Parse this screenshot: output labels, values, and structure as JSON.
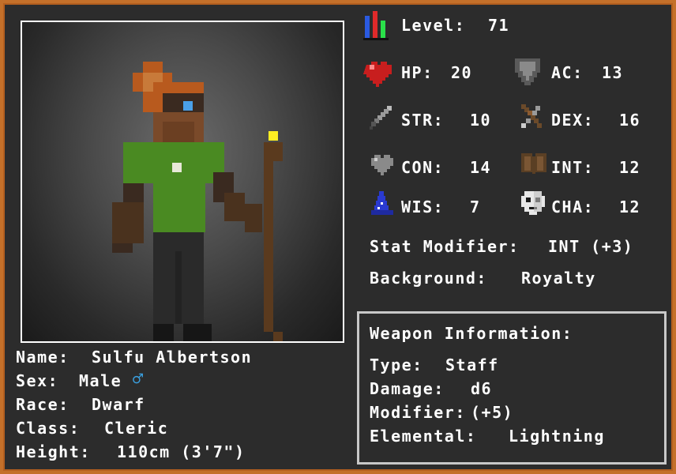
{
  "level": {
    "label": "Level:",
    "value": "71"
  },
  "stats": {
    "hp": {
      "label": "HP:",
      "value": "20"
    },
    "ac": {
      "label": "AC:",
      "value": "13"
    },
    "str": {
      "label": "STR:",
      "value": "10"
    },
    "dex": {
      "label": "DEX:",
      "value": "16"
    },
    "con": {
      "label": "CON:",
      "value": "14"
    },
    "int": {
      "label": "INT:",
      "value": "12"
    },
    "wis": {
      "label": "WIS:",
      "value": "7"
    },
    "cha": {
      "label": "CHA:",
      "value": "12"
    }
  },
  "stat_modifier": {
    "label": "Stat Modifier:",
    "value": "INT (+3)"
  },
  "background": {
    "label": "Background:",
    "value": "Royalty"
  },
  "character": {
    "name": {
      "label": "Name:",
      "value": "Sulfu Albertson"
    },
    "sex": {
      "label": "Sex:",
      "value": "Male",
      "symbol": "♂"
    },
    "race": {
      "label": "Race:",
      "value": "Dwarf"
    },
    "class": {
      "label": "Class:",
      "value": "Cleric"
    },
    "height": {
      "label": "Height:",
      "value": "110cm (3'7\")"
    }
  },
  "weapon": {
    "title": "Weapon Information:",
    "type": {
      "label": "Type:",
      "value": "Staff"
    },
    "damage": {
      "label": "Damage:",
      "value": "d6"
    },
    "modifier": {
      "label": "Modifier:",
      "value": "(+5)"
    },
    "elemental": {
      "label": "Elemental:",
      "value": "Lightning"
    }
  },
  "colors": {
    "frame": "#c4702a",
    "panel": "#2c2c2c",
    "text": "#ffffff",
    "male_symbol": "#3aa0e0"
  },
  "icons": {
    "level": "level-bars-icon",
    "hp": "heart-icon",
    "ac": "shield-icon",
    "str": "sword-icon",
    "dex": "bow-icon",
    "con": "grey-heart-icon",
    "int": "book-icon",
    "wis": "wizard-hat-icon",
    "cha": "mask-icon"
  }
}
